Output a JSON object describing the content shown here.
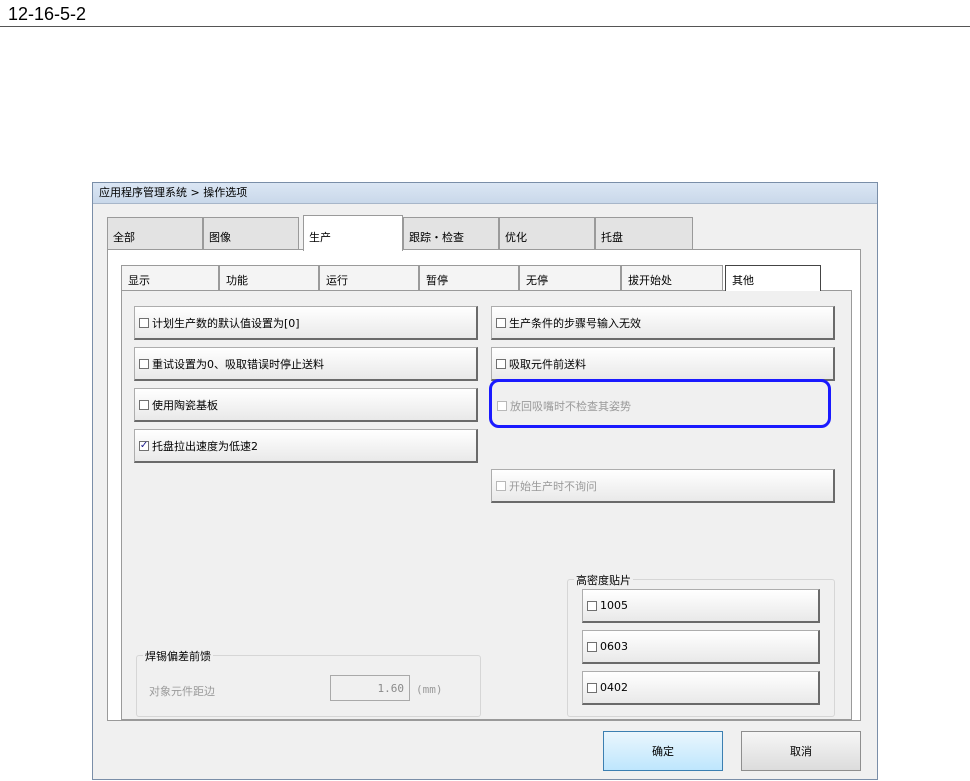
{
  "doc": {
    "ref": "12-16-5-2"
  },
  "window": {
    "title": "应用程序管理系统 > 操作选项"
  },
  "tabs_main": [
    "全部",
    "图像",
    "生产",
    "跟踪・检查",
    "优化",
    "托盘"
  ],
  "tabs_main_active": "生产",
  "tabs_sub": [
    "显示",
    "功能",
    "运行",
    "暂停",
    "无停",
    "拔开始处",
    "其他"
  ],
  "tabs_sub_active": "其他",
  "left_options": [
    {
      "label": "计划生产数的默认值设置为[0]",
      "checked": false,
      "enabled": true
    },
    {
      "label": "重试设置为0、吸取错误时停止送料",
      "checked": false,
      "enabled": true
    },
    {
      "label": "使用陶瓷基板",
      "checked": false,
      "enabled": true
    },
    {
      "label": "托盘拉出速度为低速2",
      "checked": true,
      "enabled": true
    }
  ],
  "right_options": [
    {
      "label": "生产条件的步骤号输入无效",
      "checked": false,
      "enabled": true
    },
    {
      "label": "吸取元件前送料",
      "checked": false,
      "enabled": true
    },
    {
      "label": "放回吸嘴时不检查其姿势",
      "checked": false,
      "enabled": false
    },
    {
      "label": "开始生产时不询问",
      "checked": false,
      "enabled": false
    }
  ],
  "solder_group": {
    "title": "焊锡偏差前馈",
    "field_label": "对象元件距边",
    "value": "1.60",
    "unit": "(mm)"
  },
  "hd_group": {
    "title": "高密度贴片",
    "options": [
      {
        "label": "1005",
        "checked": false
      },
      {
        "label": "0603",
        "checked": false
      },
      {
        "label": "0402",
        "checked": false
      }
    ]
  },
  "buttons": {
    "ok": "确定",
    "cancel": "取消"
  },
  "colors": {
    "highlight": "#1a1aff",
    "default_button": "#bee6fd"
  }
}
